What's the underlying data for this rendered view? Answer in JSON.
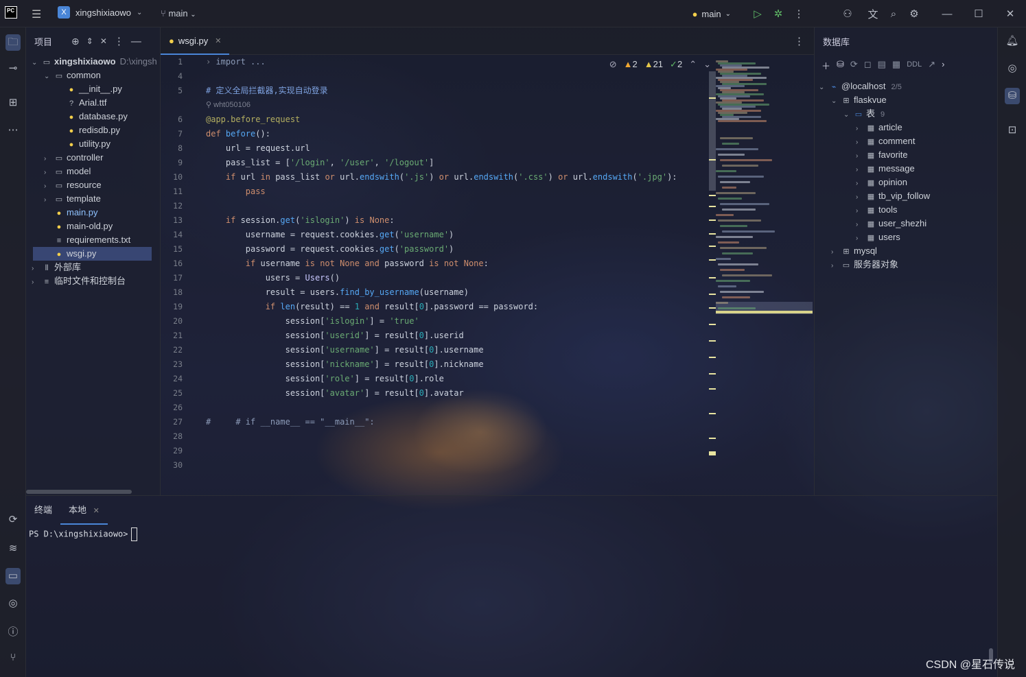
{
  "titlebar": {
    "app_logo": "PC",
    "project_badge": "X",
    "project_name": "xingshixiaowo",
    "vcs_branch": "main",
    "run_config": "main"
  },
  "project_panel": {
    "title": "项目",
    "items": [
      {
        "label": "xingshixiaowo",
        "extra": "D:\\xingsh",
        "type": "folder",
        "depth": 0,
        "open": true
      },
      {
        "label": "common",
        "type": "folder",
        "depth": 1,
        "open": true
      },
      {
        "label": "__init__.py",
        "type": "py",
        "depth": 2
      },
      {
        "label": "Arial.ttf",
        "type": "font",
        "depth": 2
      },
      {
        "label": "database.py",
        "type": "py",
        "depth": 2
      },
      {
        "label": "redisdb.py",
        "type": "py",
        "depth": 2
      },
      {
        "label": "utility.py",
        "type": "py",
        "depth": 2
      },
      {
        "label": "controller",
        "type": "folder",
        "depth": 1,
        "open": false
      },
      {
        "label": "model",
        "type": "folder",
        "depth": 1,
        "open": false
      },
      {
        "label": "resource",
        "type": "folder",
        "depth": 1,
        "open": false
      },
      {
        "label": "template",
        "type": "folder",
        "depth": 1,
        "open": false
      },
      {
        "label": "main.py",
        "type": "py",
        "depth": 1,
        "accent": true
      },
      {
        "label": "main-old.py",
        "type": "py",
        "depth": 1
      },
      {
        "label": "requirements.txt",
        "type": "txt",
        "depth": 1
      },
      {
        "label": "wsgi.py",
        "type": "py",
        "depth": 1,
        "selected": true
      },
      {
        "label": "外部库",
        "type": "lib",
        "depth": 0,
        "open": false
      },
      {
        "label": "临时文件和控制台",
        "type": "scratch",
        "depth": 0,
        "open": false
      }
    ]
  },
  "editor": {
    "tab_label": "wsgi.py",
    "warnings": "2",
    "weak_warnings": "21",
    "typos": "2",
    "author": "wht050106",
    "line_numbers": [
      "1",
      "4",
      "5",
      "6",
      "7",
      "8",
      "9",
      "10",
      "11",
      "12",
      "13",
      "14",
      "15",
      "16",
      "17",
      "18",
      "19",
      "20",
      "21",
      "22",
      "23",
      "24",
      "25",
      "26",
      "27",
      "28",
      "29",
      "30"
    ]
  },
  "database_panel": {
    "title": "数据库",
    "ddl_label": "DDL",
    "host": "@localhost",
    "host_count": "2/5",
    "schema": "flaskvue",
    "tables_label": "表",
    "tables_count": "9",
    "tables": [
      "article",
      "comment",
      "favorite",
      "message",
      "opinion",
      "tb_vip_follow",
      "tools",
      "user_shezhi",
      "users"
    ],
    "other_schema": "mysql",
    "server_objects": "服务器对象"
  },
  "terminal": {
    "tab_title": "终端",
    "tab_local": "本地",
    "prompt": "PS D:\\xingshixiaowo>"
  },
  "watermark": "CSDN @星石传说"
}
